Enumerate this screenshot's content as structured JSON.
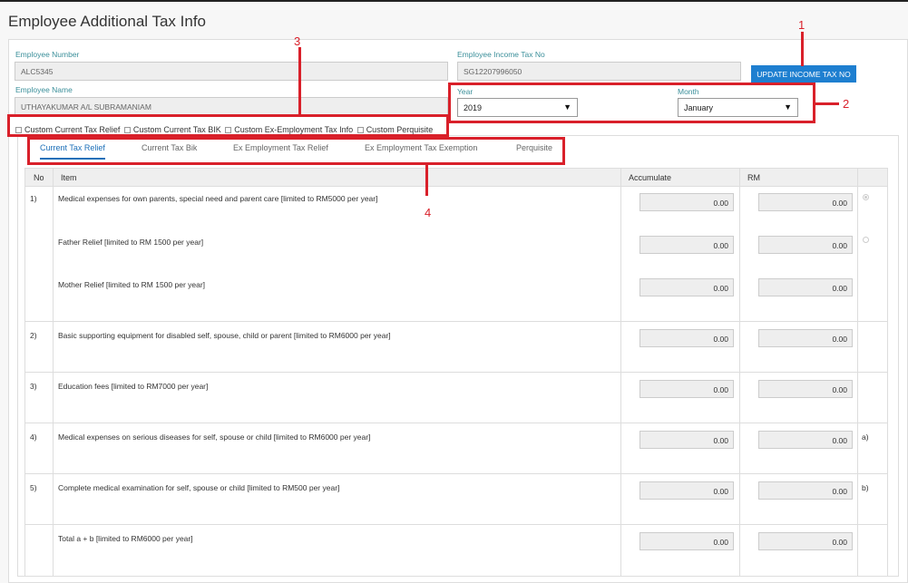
{
  "page": {
    "title": "Employee Additional Tax Info"
  },
  "employee": {
    "number_label": "Employee Number",
    "number_value": "ALC5345",
    "name_label": "Employee Name",
    "name_value": "UTHAYAKUMAR A/L SUBRAMANIAM",
    "tax_no_label": "Employee Income Tax No",
    "tax_no_value": "SG12207996050",
    "update_button": "UPDATE INCOME TAX NO"
  },
  "period": {
    "year_label": "Year",
    "year_value": "2019",
    "month_label": "Month",
    "month_value": "January"
  },
  "checkboxes": [
    "Custom Current Tax Relief",
    "Custom Current Tax BIK",
    "Custom Ex-Employment Tax Info",
    "Custom Perquisite"
  ],
  "tabs": [
    "Current Tax Relief",
    "Current Tax Bik",
    "Ex Employment Tax Relief",
    "Ex Employment Tax Exemption",
    "Perquisite"
  ],
  "active_tab": "Current Tax Relief",
  "table": {
    "headers": {
      "no": "No",
      "item": "Item",
      "accumulate": "Accumulate",
      "rm": "RM"
    },
    "rows": [
      {
        "no": "1)",
        "item": "Medical expenses for own parents, special need and parent care [limited to RM5000 per year]",
        "accumulate": "0.00",
        "rm": "0.00"
      },
      {
        "no": "",
        "item": "Father Relief [limited to RM 1500 per year]",
        "accumulate": "0.00",
        "rm": "0.00"
      },
      {
        "no": "",
        "item": "Mother Relief [limited to RM 1500 per year]",
        "accumulate": "0.00",
        "rm": "0.00"
      },
      {
        "no": "2)",
        "item": "Basic supporting equipment for disabled self, spouse, child or parent [limited to RM6000 per year]",
        "accumulate": "0.00",
        "rm": "0.00"
      },
      {
        "no": "3)",
        "item": "Education fees [limited to RM7000 per year]",
        "accumulate": "0.00",
        "rm": "0.00"
      },
      {
        "no": "4)",
        "item": "Medical expenses on serious diseases for self, spouse or child [limited to RM6000 per year]",
        "accumulate": "0.00",
        "rm": "0.00",
        "note": "a)"
      },
      {
        "no": "5)",
        "item": "Complete medical examination for self, spouse or child [limited to RM500 per year]",
        "accumulate": "0.00",
        "rm": "0.00",
        "note": "b)"
      },
      {
        "no": "",
        "item": "Total a + b [limited to RM6000 per year]",
        "accumulate": "0.00",
        "rm": "0.00"
      }
    ]
  },
  "annotations": [
    "1",
    "2",
    "3",
    "4"
  ],
  "colors": {
    "accent": "#1e7fd0",
    "label": "#3b8f9a",
    "annotation": "#d9202a"
  }
}
